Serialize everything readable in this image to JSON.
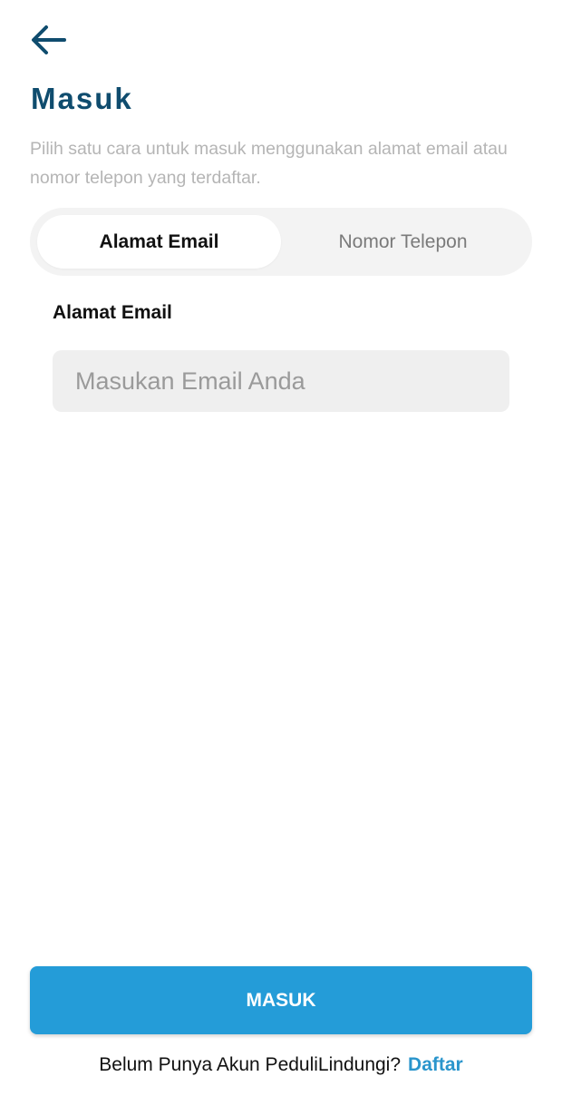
{
  "header": {
    "back_icon": "arrow-left-icon",
    "title": "Masuk",
    "subtitle": "Pilih satu cara untuk masuk menggunakan alamat email atau nomor telepon yang terdaftar."
  },
  "tabs": [
    {
      "label": "Alamat Email",
      "active": true
    },
    {
      "label": "Nomor Telepon",
      "active": false
    }
  ],
  "form": {
    "email_label": "Alamat Email",
    "email_value": "",
    "email_placeholder": "Masukan Email Anda"
  },
  "actions": {
    "submit_label": "MASUK",
    "register_prompt": "Belum Punya Akun PeduliLindungi?",
    "register_link": "Daftar"
  },
  "colors": {
    "title": "#0f4c6e",
    "primary": "#249cd8",
    "link": "#2a95cc",
    "subtitle": "#b5b5b5",
    "tab_track": "#f3f3f3",
    "input_bg": "#efefef"
  }
}
